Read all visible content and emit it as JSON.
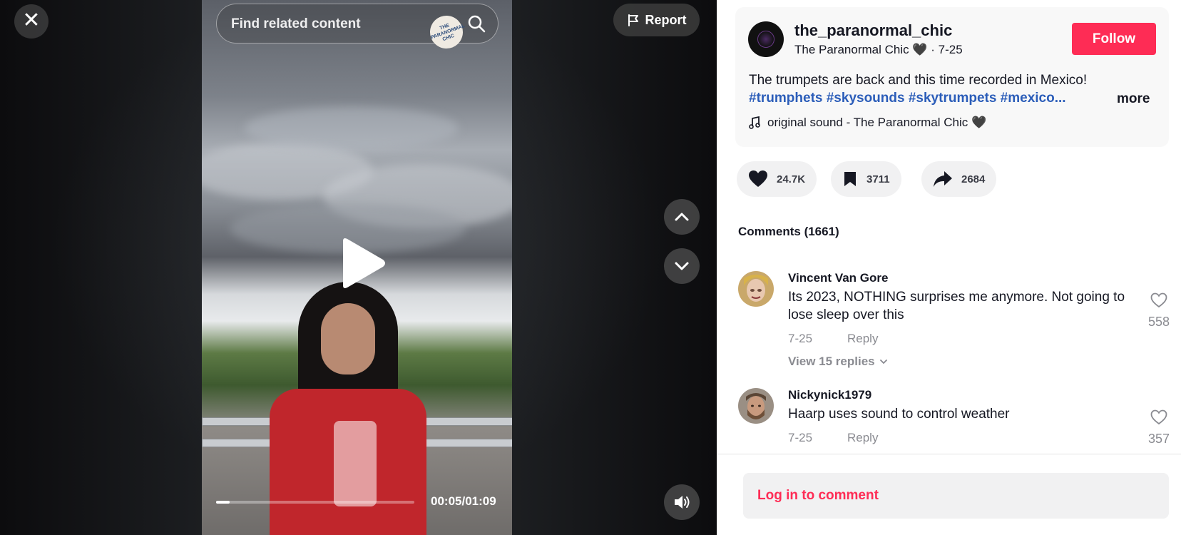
{
  "video": {
    "close_icon": "close-icon",
    "search": {
      "placeholder": "Find related content",
      "icon": "search-icon"
    },
    "watermark_text": "THE PARANORMAL CHIC",
    "report_label": "Report",
    "progress_fraction": 0.07,
    "time": "00:05/01:09",
    "nav": {
      "up_icon": "chevron-up-icon",
      "down_icon": "chevron-down-icon"
    },
    "volume_icon": "speaker-icon"
  },
  "post": {
    "username": "the_paranormal_chic",
    "nickname": "The Paranormal Chic 🖤 · 7-25",
    "follow_label": "Follow",
    "caption": "The trumpets are back and this time recorded in Mexico!",
    "hashtags": "#trumphets #skysounds #skytrumpets #mexico...",
    "more_label": "more",
    "music": "original sound - The Paranormal Chic 🖤"
  },
  "actions": {
    "likes": "24.7K",
    "saves": "3711",
    "shares": "2684"
  },
  "comments": {
    "title": "Comments (1661)",
    "items": [
      {
        "user": "Vincent Van Gore",
        "text": "Its 2023, NOTHING surprises me anymore. Not going to lose sleep over this",
        "date": "7-25",
        "reply_label": "Reply",
        "likes": "558",
        "view_replies": "View 15 replies"
      },
      {
        "user": "Nickynick1979",
        "text": "Haarp uses sound to control weather",
        "date": "7-25",
        "reply_label": "Reply",
        "likes": "357"
      }
    ],
    "login_label": "Log in to comment"
  },
  "colors": {
    "accent": "#fe2c55",
    "hashtag": "#2b5db9",
    "muted": "#8a8b91"
  }
}
